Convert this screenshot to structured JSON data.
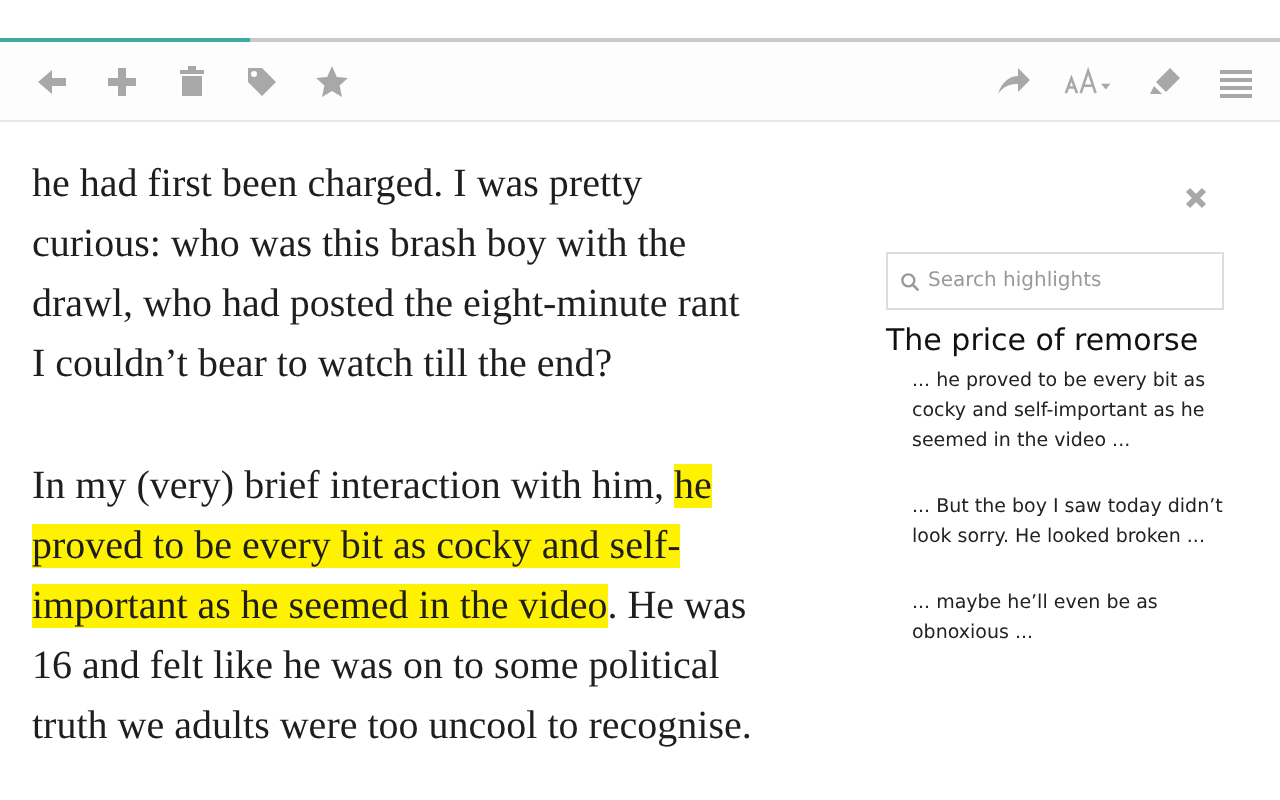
{
  "progress": {
    "level": 0.195
  },
  "article": [
    {
      "segments": [
        {
          "text": "he had first been charged. I was pretty\ncurious: who was this brash boy with the\ndrawl, who had posted the eight-minute rant\nI couldn’t bear to watch till the end?",
          "highlighted": false
        }
      ]
    },
    {
      "segments": [
        {
          "text": "In my (very) brief interaction with him, ",
          "highlighted": false
        },
        {
          "text": "he\nproved to be every bit as cocky and self-\nimportant as he seemed in the video",
          "highlighted": true
        },
        {
          "text": ". He was\n16 and felt like he was on to some political\ntruth we adults were too uncool to recognise.",
          "highlighted": false
        }
      ]
    }
  ],
  "sidebar": {
    "search": {
      "placeholder": "Search highlights"
    },
    "title": "The price of remorse",
    "highlights": [
      "... he proved to be every bit as cocky and self-important as he seemed in the video ...",
      "... But the boy I saw today didn’t look sorry. He looked broken ...",
      "... maybe he’ll even be as obnoxious ..."
    ]
  }
}
